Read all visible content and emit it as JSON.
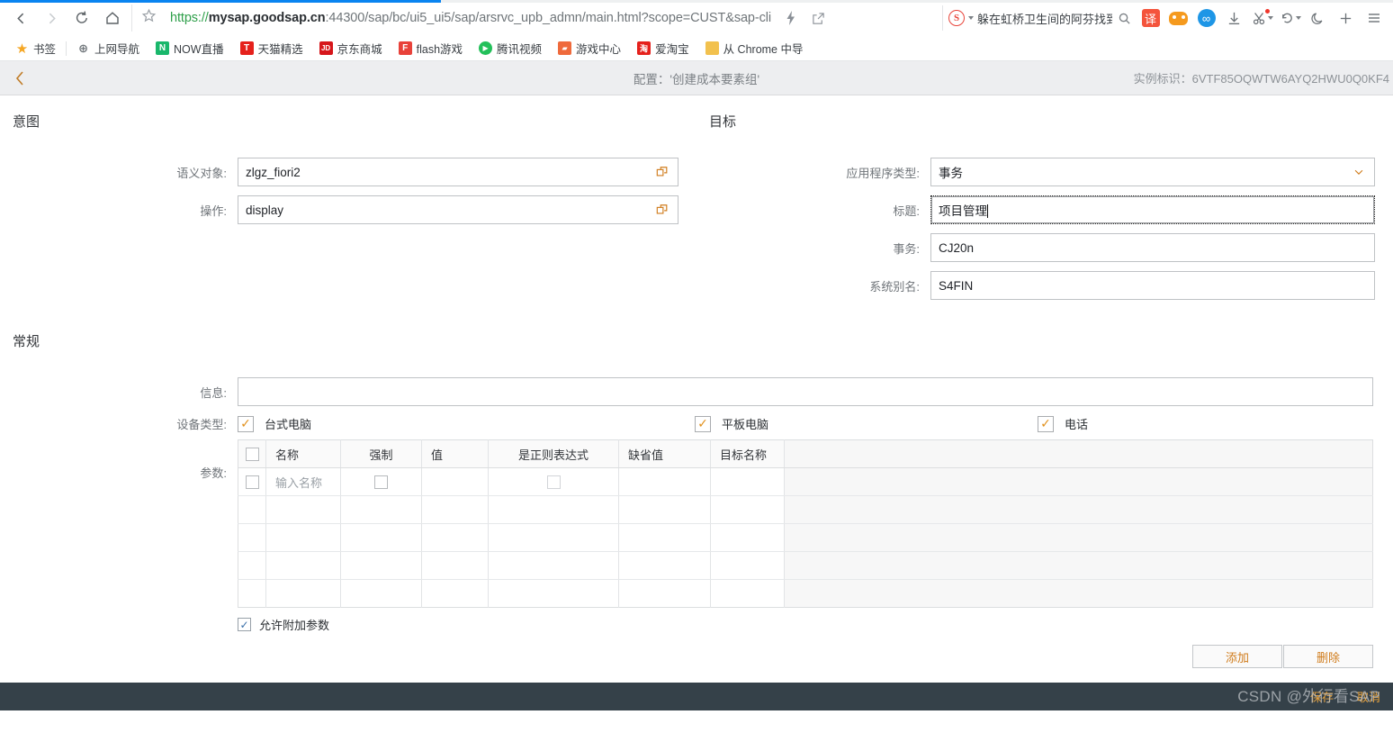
{
  "browser": {
    "nav": {
      "back": "back-arrow",
      "forward": "forward-arrow",
      "reload": "reload",
      "home": "home"
    },
    "url": {
      "scheme": "https://",
      "host": "mysap.goodsap.cn",
      "path": ":44300/sap/bc/ui5_ui5/sap/arsrvc_upb_admn/main.html?scope=CUST&sap-cli",
      "star_title": "bookmark-star"
    },
    "search": {
      "engine_badge": "S",
      "term": "躲在虹桥卫生间的阿芬找到",
      "go": "search-icon"
    },
    "toolbar_icons": [
      {
        "name": "translate-icon",
        "glyph": "译"
      },
      {
        "name": "game-center-icon",
        "glyph": ""
      },
      {
        "name": "infinity-icon",
        "glyph": "∞"
      },
      {
        "name": "download-icon",
        "glyph": "↓"
      },
      {
        "name": "screenshot-scissors-icon",
        "glyph": "✂"
      },
      {
        "name": "history-undo-icon",
        "glyph": "↺"
      },
      {
        "name": "night-mode-icon",
        "glyph": "☾"
      },
      {
        "name": "add-icon",
        "glyph": "+"
      },
      {
        "name": "menu-icon",
        "glyph": "≡"
      }
    ],
    "bookmarks": [
      {
        "label": "书签",
        "fav": "★",
        "color": "#f5a623",
        "star": true
      },
      {
        "label": "上网导航",
        "fav": "⊕",
        "color": "#6e7479",
        "plain": true
      },
      {
        "label": "NOW直播",
        "fav": "N",
        "color": "#19b76b"
      },
      {
        "label": "天猫精选",
        "fav": "T",
        "color": "#e5211c"
      },
      {
        "label": "京东商城",
        "fav": "JD",
        "color": "#d6161b"
      },
      {
        "label": "flash游戏",
        "fav": "F",
        "color": "#e8423a"
      },
      {
        "label": "腾讯视频",
        "fav": "▶",
        "color": "#23c05a"
      },
      {
        "label": "游戏中心",
        "fav": "🎮",
        "color": "#ef6a3c"
      },
      {
        "label": "爱淘宝",
        "fav": "淘",
        "color": "#e5211c"
      },
      {
        "label": "从 Chrome 中导",
        "fav": "▯",
        "color": "#f2c14e",
        "folder": true
      }
    ]
  },
  "app": {
    "header": {
      "back_icon": "back-chevron-icon",
      "title": "配置：'创建成本要素组'",
      "instance_label": "实例标识：6VTF85OQWTW6AYQ2HWU0Q0KF4"
    },
    "intent": {
      "section_title": "意图",
      "fields": [
        {
          "label": "语义对象:",
          "value": "zlgz_fiori2",
          "button": "value-help-icon"
        },
        {
          "label": "操作:",
          "value": "display",
          "button": "value-help-icon"
        }
      ]
    },
    "target": {
      "section_title": "目标",
      "app_type": {
        "label": "应用程序类型:",
        "value": "事务",
        "control": "dropdown"
      },
      "title_field": {
        "label": "标题:",
        "value": "项目管理",
        "focused": true
      },
      "transaction": {
        "label": "事务:",
        "value": "CJ20n"
      },
      "system_alias": {
        "label": "系统别名:",
        "value": "S4FIN"
      }
    },
    "general": {
      "section_title": "常规",
      "info": {
        "label": "信息:",
        "value": "",
        "placeholder": ""
      },
      "device_types": {
        "label": "设备类型:",
        "options": [
          {
            "label": "台式电脑",
            "checked": true
          },
          {
            "label": "平板电脑",
            "checked": true
          },
          {
            "label": "电话",
            "checked": true
          }
        ]
      },
      "parameters": {
        "label": "参数:",
        "columns": [
          "名称",
          "强制",
          "值",
          "是正则表达式",
          "缺省值",
          "目标名称"
        ],
        "rows": [
          {
            "select": false,
            "name_placeholder": "输入名称",
            "mandatory": false,
            "value": "",
            "is_regex": false,
            "default": "",
            "target_name": ""
          },
          {
            "select": null,
            "name_placeholder": "",
            "mandatory": null,
            "value": "",
            "is_regex": null,
            "default": "",
            "target_name": ""
          },
          {
            "select": null,
            "name_placeholder": "",
            "mandatory": null,
            "value": "",
            "is_regex": null,
            "default": "",
            "target_name": ""
          },
          {
            "select": null,
            "name_placeholder": "",
            "mandatory": null,
            "value": "",
            "is_regex": null,
            "default": "",
            "target_name": ""
          },
          {
            "select": null,
            "name_placeholder": "",
            "mandatory": null,
            "value": "",
            "is_regex": null,
            "default": "",
            "target_name": ""
          }
        ],
        "allow_additional": {
          "label": "允许附加参数",
          "checked": true
        },
        "add_button": "添加",
        "delete_button": "删除"
      }
    },
    "footer": {
      "save_button": "保存",
      "cancel_button": "取消"
    },
    "watermark": "CSDN @外行看SAP"
  }
}
